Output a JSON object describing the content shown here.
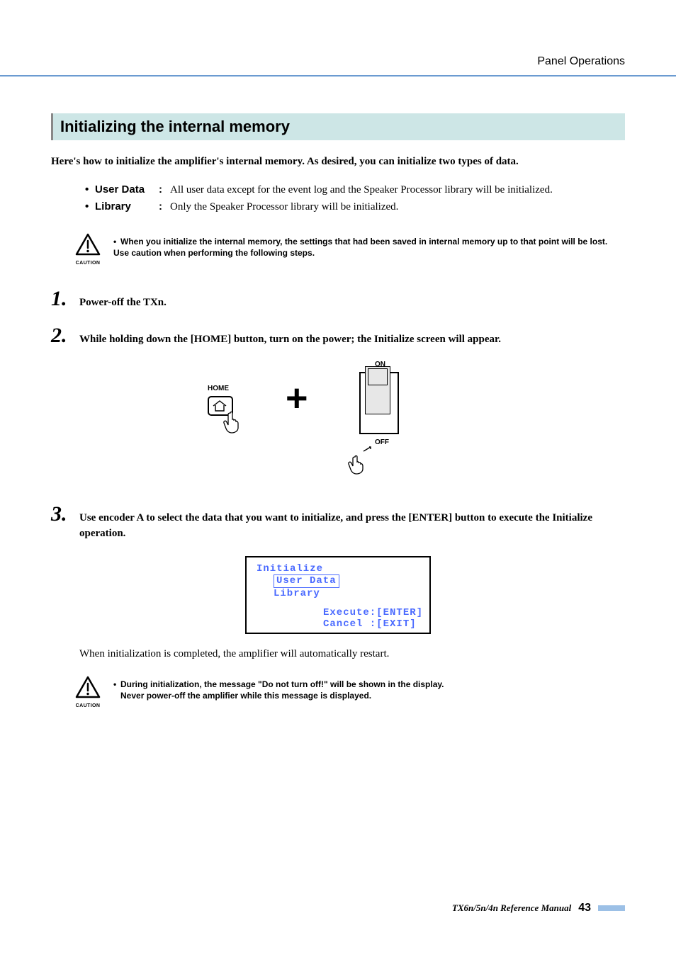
{
  "header": {
    "breadcrumb": "Panel Operations"
  },
  "section": {
    "title": "Initializing the internal memory"
  },
  "intro": "Here's how to initialize the amplifier's internal memory. As desired, you can initialize two types of data.",
  "definitions": [
    {
      "term": "User Data",
      "desc": "All user data except for the event log and the Speaker Processor library will be initialized."
    },
    {
      "term": "Library",
      "desc": "Only the Speaker Processor library will be initialized."
    }
  ],
  "caution1": {
    "label": "CAUTION",
    "text": "When you initialize the internal memory, the settings that had been saved in internal memory up to that point will be lost. Use caution when performing the following steps."
  },
  "steps": {
    "s1": {
      "num": "1.",
      "text": "Power-off the TXn."
    },
    "s2": {
      "num": "2.",
      "text": "While holding down the [HOME] button, turn on the power; the Initialize screen will appear."
    },
    "s3": {
      "num": "3.",
      "text": "Use encoder A to select the data that you want to initialize, and press the [ENTER] button to execute the Initialize operation."
    }
  },
  "diagram": {
    "home_label": "HOME",
    "on_label": "ON",
    "off_label": "OFF",
    "plus": "+"
  },
  "lcd": {
    "title": "Initialize",
    "selected": "User Data",
    "other": "Library",
    "execute": "Execute:[ENTER]",
    "cancel": "Cancel :[EXIT]"
  },
  "note": "When initialization is completed, the amplifier will automatically restart.",
  "caution2": {
    "label": "CAUTION",
    "line1": "During initialization, the message \"Do not turn off!\" will be shown in the display.",
    "line2": "Never power-off the amplifier while this message is displayed."
  },
  "footer": {
    "manual": "TX6n/5n/4n  Reference Manual",
    "page": "43"
  }
}
